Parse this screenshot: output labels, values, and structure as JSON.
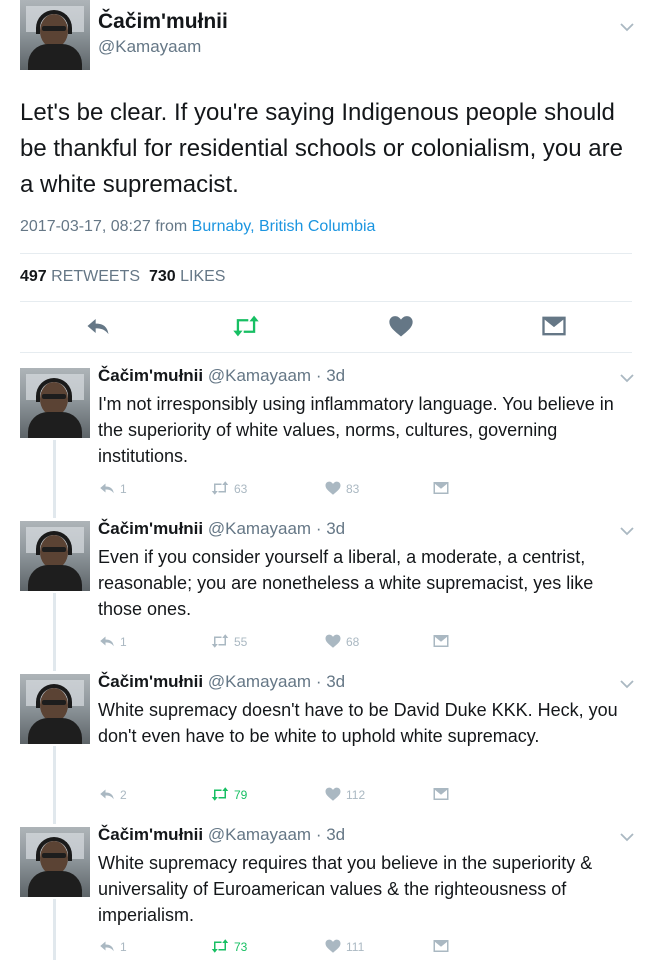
{
  "main_tweet": {
    "display_name": "Čačim'mułnii",
    "handle": "@Kamayaam",
    "text": "Let's be clear. If you're saying Indigenous people should be thankful for residential schools or colonialism, you are a white supremacist.",
    "timestamp": "2017-03-17, 08:27 from",
    "location": "Burnaby, British Columbia",
    "retweets_count": "497",
    "retweets_label": "RETWEETS",
    "likes_count": "730",
    "likes_label": "LIKES"
  },
  "replies": [
    {
      "display_name": "Čačim'mułnii",
      "handle_time": "@Kamayaam · 3d",
      "text": "I'm not irresponsibly using inflammatory language. You believe in the superiority of white values, norms, cultures, governing institutions.",
      "reply_count": "1",
      "retweet_count": "63",
      "like_count": "83"
    },
    {
      "display_name": "Čačim'mułnii",
      "handle_time": "@Kamayaam · 3d",
      "text": "Even if you consider yourself a liberal, a moderate, a centrist, reasonable; you are nonetheless a white supremacist, yes like those ones.",
      "reply_count": "1",
      "retweet_count": "55",
      "like_count": "68"
    },
    {
      "display_name": "Čačim'mułnii",
      "handle_time": "@Kamayaam · 3d",
      "text": "White supremacy doesn't have to be David Duke KKK. Heck, you don't even have to be white to uphold white supremacy.",
      "reply_count": "2",
      "retweet_count": "79",
      "like_count": "112"
    },
    {
      "display_name": "Čačim'mułnii",
      "handle_time": "@Kamayaam · 3d",
      "text": "White supremacy requires that you believe in the superiority & universality of Euroamerican values & the righteousness of imperialism.",
      "reply_count": "1",
      "retweet_count": "73",
      "like_count": "111"
    }
  ],
  "colors": {
    "retweet_active": "#17bf63",
    "link": "#1b95e0",
    "muted": "#657786",
    "icon_gray": "#aab8c2"
  },
  "icons": [
    "reply-icon",
    "retweet-icon",
    "like-icon",
    "direct-message-icon",
    "chevron-down-icon"
  ]
}
